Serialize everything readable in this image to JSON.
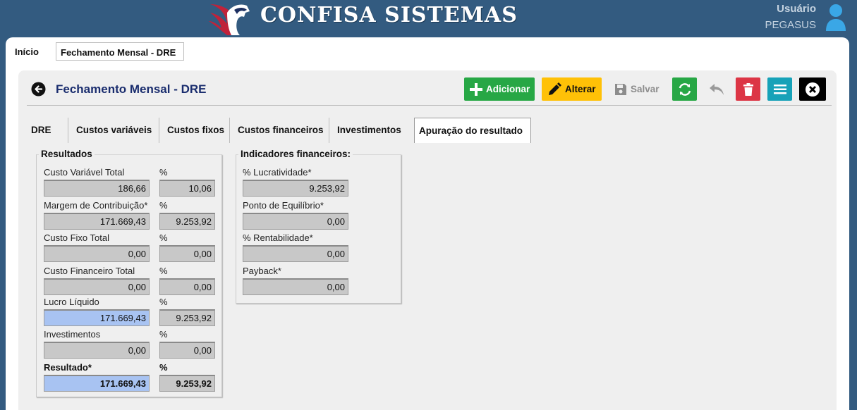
{
  "header": {
    "brand": "CONFISA SISTEMAS",
    "user_label": "Usuário",
    "user_name": "PEGASUS"
  },
  "page_tabs": [
    {
      "label": "Início"
    },
    {
      "label": "Fechamento Mensal - DRE"
    }
  ],
  "page": {
    "title": "Fechamento Mensal - DRE"
  },
  "toolbar": {
    "add": "Adicionar",
    "edit": "Alterar",
    "save": "Salvar"
  },
  "section_tabs": [
    {
      "label": "DRE"
    },
    {
      "label": "Custos variáveis"
    },
    {
      "label": "Custos fixos"
    },
    {
      "label": "Custos financeiros"
    },
    {
      "label": "Investimentos"
    },
    {
      "label": "Apuração do resultado"
    }
  ],
  "results": {
    "title": "Resultados",
    "percent_label": "%",
    "rows": [
      {
        "label": "Custo Variável Total",
        "value": "186,66",
        "percent": "10,06"
      },
      {
        "label": "Margem de Contribuição*",
        "value": "171.669,43",
        "percent": "9.253,92"
      },
      {
        "label": "Custo Fixo Total",
        "value": "0,00",
        "percent": "0,00"
      },
      {
        "label": "Custo Financeiro Total",
        "value": "0,00",
        "percent": "0,00"
      },
      {
        "label": "Lucro Líquido",
        "value": "171.669,43",
        "percent": "9.253,92"
      },
      {
        "label": "Investimentos",
        "value": "0,00",
        "percent": "0,00"
      },
      {
        "label": "Resultado*",
        "value": "171.669,43",
        "percent": "9.253,92"
      }
    ]
  },
  "indicators": {
    "title": "Indicadores financeiros:",
    "rows": [
      {
        "label": "% Lucratividade*",
        "value": "9.253,92"
      },
      {
        "label": "Ponto de Equilíbrio*",
        "value": "0,00"
      },
      {
        "label": "% Rentabilidade*",
        "value": "0,00"
      },
      {
        "label": "Payback*",
        "value": "0,00"
      }
    ]
  },
  "colors": {
    "header_bg": "#335b80",
    "add": "#27a745",
    "edit": "#ffc107",
    "delete": "#dc3545",
    "menu": "#17a2b8",
    "highlight_field": "#a8c3f2"
  }
}
